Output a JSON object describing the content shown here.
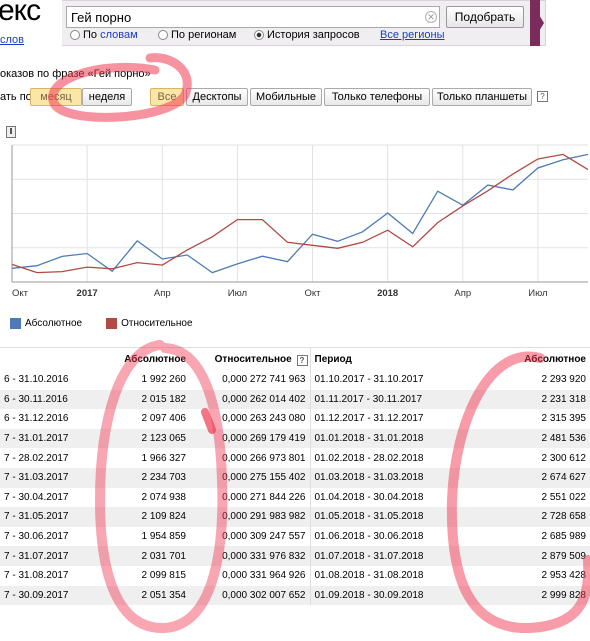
{
  "logo": {
    "text": "екс",
    "sub": "слов"
  },
  "search": {
    "query": "Гей порно",
    "submit_label": "Подобрать",
    "modes": [
      {
        "label_prefix": "По ",
        "label_main": "словам",
        "selected": false
      },
      {
        "label_prefix": "",
        "label_main": "По регионам",
        "selected": false
      },
      {
        "label_prefix": "",
        "label_main": "История запросов",
        "selected": true
      }
    ],
    "all_regions": "Все регионы"
  },
  "header": {
    "phrase": "оказов по фразе «Гей порно»"
  },
  "filters": {
    "label": "ать по:",
    "period": [
      {
        "label": "месяц",
        "active": true
      },
      {
        "label": "неделя",
        "active": false
      }
    ],
    "device": [
      {
        "label": "Все",
        "active": true
      },
      {
        "label": "Десктопы",
        "active": false
      },
      {
        "label": "Мобильные",
        "active": false
      },
      {
        "label": "Только телефоны",
        "active": false
      },
      {
        "label": "Только планшеты",
        "active": false
      }
    ],
    "help": "?"
  },
  "slider_icon": "drag-handle-icon",
  "chart_data": {
    "type": "line",
    "x": [
      "Окт",
      "",
      "",
      "",
      "",
      "",
      "",
      "",
      "",
      "",
      "",
      "",
      "",
      "",
      "",
      "",
      "",
      "",
      "",
      "",
      "",
      "",
      "",
      ""
    ],
    "x_ticks": [
      {
        "label": "Окт",
        "bold": false,
        "index": 0
      },
      {
        "label": "2017",
        "bold": true,
        "index": 3
      },
      {
        "label": "Апр",
        "bold": false,
        "index": 6
      },
      {
        "label": "Июл",
        "bold": false,
        "index": 9
      },
      {
        "label": "Окт",
        "bold": false,
        "index": 12
      },
      {
        "label": "2018",
        "bold": true,
        "index": 15
      },
      {
        "label": "Апр",
        "bold": false,
        "index": 18
      },
      {
        "label": "Июл",
        "bold": false,
        "index": 21
      }
    ],
    "series": [
      {
        "name": "Абсолютное",
        "color": "#4e7bb5",
        "values": [
          1992260,
          2015182,
          2097406,
          2123065,
          1966327,
          2234703,
          2074938,
          2109824,
          1954859,
          2031701,
          2099815,
          2051354,
          2293920,
          2231318,
          2315395,
          2481536,
          2300612,
          2674627,
          2551022,
          2728658,
          2685989,
          2879509,
          2953428,
          2999828
        ]
      },
      {
        "name": "Относительное",
        "color": "#b04a43",
        "values": [
          0.000272741963,
          0.000262014402,
          0.00026324308,
          0.000269179419,
          0.000266973801,
          0.000275155402,
          0.000271844226,
          0.000291983982,
          0.000309247557,
          0.000331976832,
          0.000331964926,
          0.000302007652,
          0.000298,
          0.000294,
          0.000302,
          0.000318,
          0.000296,
          0.000328,
          0.00035,
          0.00037,
          0.000392,
          0.000412,
          0.000418,
          0.000398
        ]
      }
    ],
    "legend": "bottom-left",
    "grid": true
  },
  "table": {
    "headers_left": [
      "",
      "Абсолютное",
      "Относительное"
    ],
    "headers_right": [
      "Период",
      "Абсолютное"
    ],
    "help": "?",
    "rows_left": [
      [
        "6 - 31.10.2016",
        "1 992 260",
        "0,000 272 741 963"
      ],
      [
        "6 - 30.11.2016",
        "2 015 182",
        "0,000 262 014 402"
      ],
      [
        "6 - 31.12.2016",
        "2 097 406",
        "0,000 263 243 080"
      ],
      [
        "7 - 31.01.2017",
        "2 123 065",
        "0,000 269 179 419"
      ],
      [
        "7 - 28.02.2017",
        "1 966 327",
        "0,000 266 973 801"
      ],
      [
        "7 - 31.03.2017",
        "2 234 703",
        "0,000 275 155 402"
      ],
      [
        "7 - 30.04.2017",
        "2 074 938",
        "0,000 271 844 226"
      ],
      [
        "7 - 31.05.2017",
        "2 109 824",
        "0,000 291 983 982"
      ],
      [
        "7 - 30.06.2017",
        "1 954 859",
        "0,000 309 247 557"
      ],
      [
        "7 - 31.07.2017",
        "2 031 701",
        "0,000 331 976 832"
      ],
      [
        "7 - 31.08.2017",
        "2 099 815",
        "0,000 331 964 926"
      ],
      [
        "7 - 30.09.2017",
        "2 051 354",
        "0,000 302 007 652"
      ]
    ],
    "rows_right": [
      [
        "01.10.2017 - 31.10.2017",
        "2 293 920"
      ],
      [
        "01.11.2017 - 30.11.2017",
        "2 231 318"
      ],
      [
        "01.12.2017 - 31.12.2017",
        "2 315 395"
      ],
      [
        "01.01.2018 - 31.01.2018",
        "2 481 536"
      ],
      [
        "01.02.2018 - 28.02.2018",
        "2 300 612"
      ],
      [
        "01.03.2018 - 31.03.2018",
        "2 674 627"
      ],
      [
        "01.04.2018 - 30.04.2018",
        "2 551 022"
      ],
      [
        "01.05.2018 - 31.05.2018",
        "2 728 658"
      ],
      [
        "01.06.2018 - 30.06.2018",
        "2 685 989"
      ],
      [
        "01.07.2018 - 31.07.2018",
        "2 879 509"
      ],
      [
        "01.08.2018 - 31.08.2018",
        "2 953 428"
      ],
      [
        "01.09.2018 - 30.09.2018",
        "2 999 828"
      ]
    ]
  },
  "colors": {
    "annotation": "#f03a52",
    "active_filter": "#fbe6a9",
    "link": "#1a3dc1",
    "brand_band": "#7c2b5d"
  }
}
